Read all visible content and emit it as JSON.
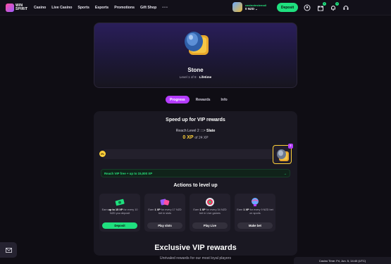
{
  "header": {
    "logo_text": "WIN SPIRIT",
    "nav": [
      "Casino",
      "Live Casino",
      "Sports",
      "Esports",
      "Promotions",
      "Gift Shop"
    ],
    "more": "•••",
    "username": "casinotestemail",
    "balance": "0 NZD",
    "deposit_label": "Deposit",
    "gift_badge": "1",
    "bell_badge": "3"
  },
  "hero": {
    "title": "Stone",
    "level_text": "Level 1 of 8 · ",
    "level_suffix": "Lifetime"
  },
  "tabs": [
    "Progress",
    "Rewards",
    "Info"
  ],
  "progress": {
    "title": "Speed up for VIP rewards",
    "reach_prefix": "Reach Level 2",
    "reach_arrows": ":::>",
    "reach_target": "Slate",
    "xp_value": "0 XP",
    "xp_of": "of 24 XP",
    "percent_label": "0%",
    "progress_fraction": 0,
    "next_level_num": "2",
    "promo_text": "Reach VIP free + up to 15,000 XP",
    "promo_arrow": "→"
  },
  "actions": {
    "title": "Actions to level up",
    "cards": [
      {
        "pre": "Earn ",
        "bold": "up to 15 XP",
        "post": " for every 10 NZD you deposit",
        "button": "Deposit"
      },
      {
        "pre": "Earn ",
        "bold": "1 XP",
        "post": " for every 17 NZD bet in slots",
        "button": "Play slots"
      },
      {
        "pre": "Earn ",
        "bold": "1 XP",
        "post": " for every 34 NZD bet in Live games",
        "button": "Play Live"
      },
      {
        "pre": "Earn ",
        "bold": "1 XP",
        "post": " for every 9 NZD bet on sports",
        "button": "Make bet"
      }
    ]
  },
  "exclusive": {
    "title": "Exclusive VIP rewards",
    "subtitle": "Unrivaled rewards for our most loyal players"
  },
  "footer": {
    "casino_time": "Casino Time: Fri, Jun. 5, 14:40 (UTC)"
  },
  "colors": {
    "accent_green": "#1fe07f",
    "accent_purple": "#b53cff",
    "xp_yellow": "#ffd13a"
  }
}
